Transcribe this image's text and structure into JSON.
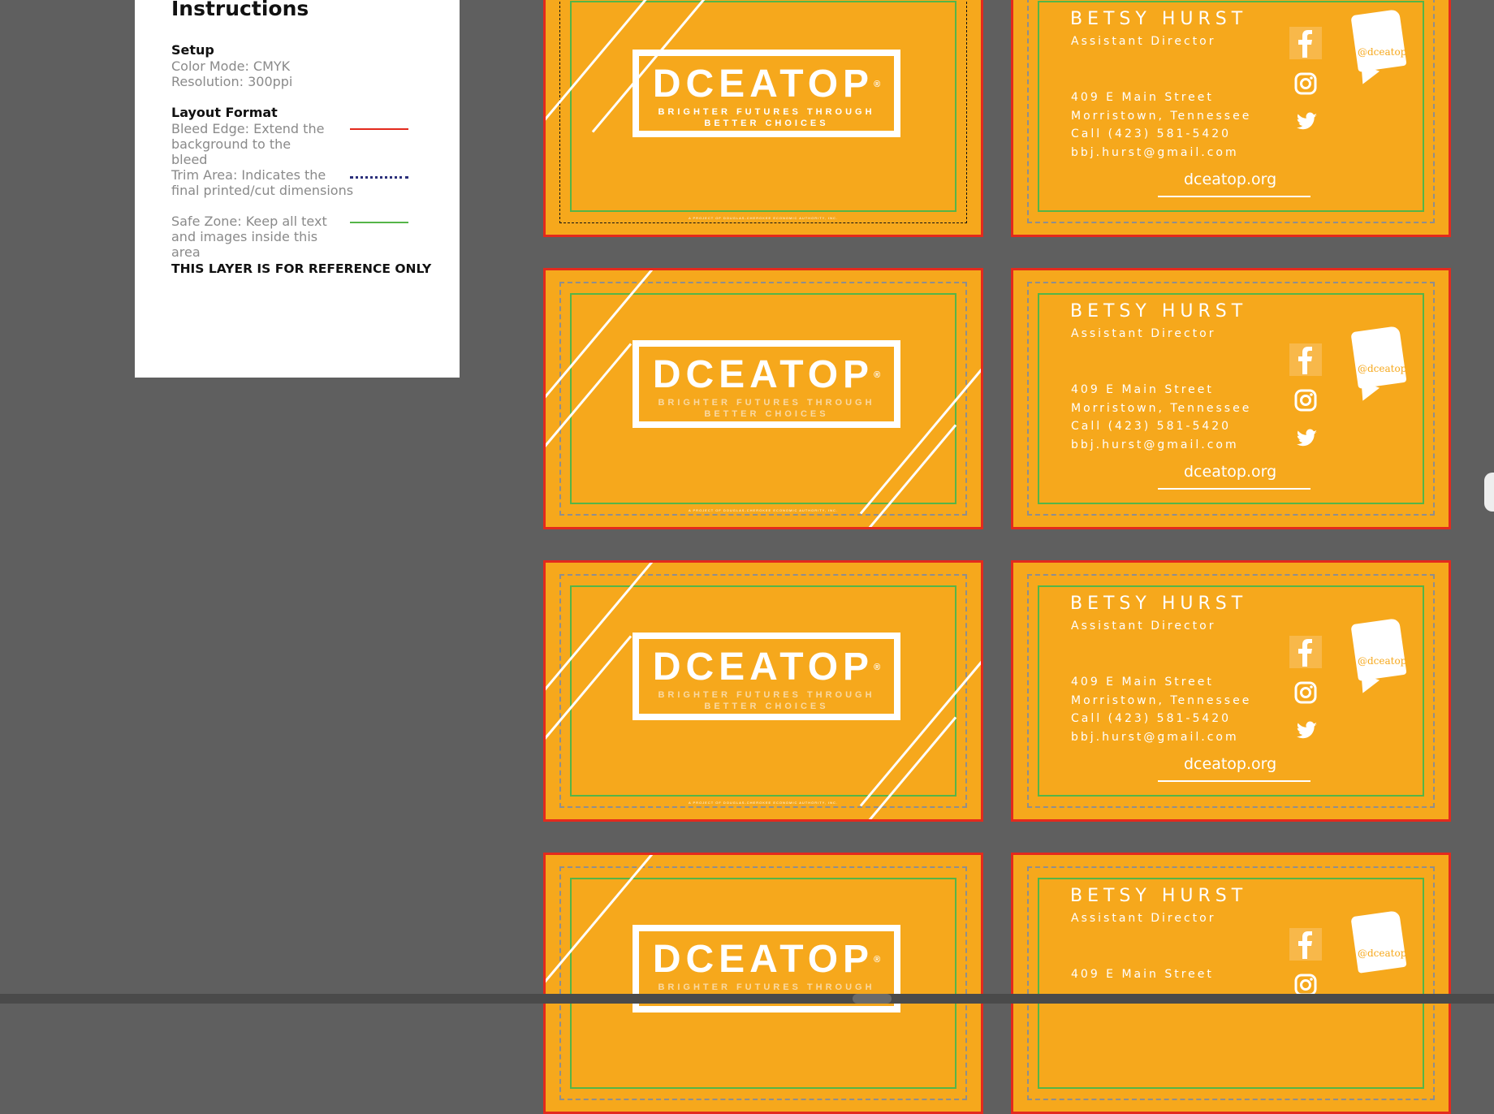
{
  "panel": {
    "title": "Instructions",
    "setup_heading": "Setup",
    "color_mode": "Color Mode: CMYK",
    "resolution": "Resolution: 300ppi",
    "layout_heading": "Layout Format",
    "bleed_text": "Bleed Edge: Extend the background to the bleed",
    "trim_text": "Trim Area: Indicates the final printed/cut dimensions",
    "safe_text": "Safe Zone: Keep all text and images inside this area",
    "reference_note": "THIS LAYER IS FOR REFERENCE ONLY"
  },
  "front": {
    "logo_word": "DCEATOP",
    "logo_reg": "®",
    "tagline_1": "BRIGHTER FUTURES THROUGH",
    "tagline_2": "BETTER CHOICES",
    "fine_print": "A PROJECT OF DOUGLAS-CHEROKEE ECONOMIC AUTHORITY, INC."
  },
  "back": {
    "name": "BETSY HURST",
    "role": "Assistant Director",
    "address_1": "409 E Main Street",
    "address_2": "Morristown, Tennessee",
    "phone": "Call (423) 581-5420",
    "email": "bbj.hurst@gmail.com",
    "website": "dceatop.org",
    "handle": "@dceatop"
  },
  "colors": {
    "card_orange": "#f6a81c",
    "bleed_red": "#e32a1d",
    "trim_navy": "#2b2f7a",
    "safe_green": "#55b548",
    "canvas_gray": "#5f5f5f"
  },
  "icons": [
    "facebook-icon",
    "instagram-icon",
    "twitter-icon",
    "speech-bubble-icon"
  ]
}
